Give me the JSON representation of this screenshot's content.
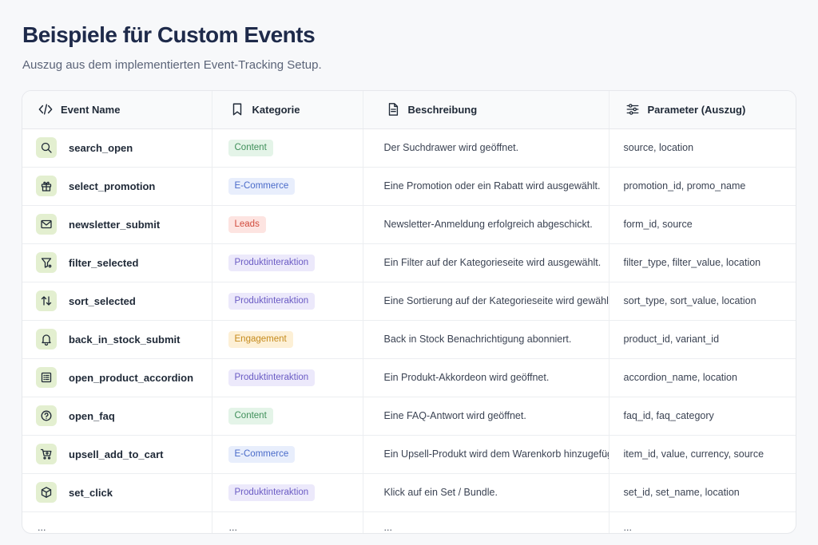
{
  "page": {
    "title": "Beispiele für Custom Events",
    "subtitle": "Auszug aus dem implementierten Event-Tracking Setup."
  },
  "table": {
    "headers": [
      {
        "label": "Event Name",
        "icon": "code-icon"
      },
      {
        "label": "Kategorie",
        "icon": "bookmark-icon"
      },
      {
        "label": "Beschreibung",
        "icon": "document-icon"
      },
      {
        "label": "Parameter (Auszug)",
        "icon": "sliders-icon"
      }
    ],
    "rows": [
      {
        "name": "search_open",
        "icon": "search-icon",
        "category": "Content",
        "description": "Der Suchdrawer wird geöffnet.",
        "params": "source, location"
      },
      {
        "name": "select_promotion",
        "icon": "gift-icon",
        "category": "E-Commerce",
        "description": "Eine Promotion oder ein Rabatt wird ausgewählt.",
        "params": "promotion_id, promo_name"
      },
      {
        "name": "newsletter_submit",
        "icon": "mail-icon",
        "category": "Leads",
        "description": "Newsletter-Anmeldung erfolgreich abgeschickt.",
        "params": "form_id, source"
      },
      {
        "name": "filter_selected",
        "icon": "filter-icon",
        "category": "Produktinteraktion",
        "description": "Ein Filter auf der Kategorieseite wird ausgewählt.",
        "params": "filter_type, filter_value, location"
      },
      {
        "name": "sort_selected",
        "icon": "sort-arrows-icon",
        "category": "Produktinteraktion",
        "description": "Eine Sortierung auf der Kategorieseite wird gewählt.",
        "params": "sort_type, sort_value, location"
      },
      {
        "name": "back_in_stock_submit",
        "icon": "bell-icon",
        "category": "Engagement",
        "description": "Back in Stock Benachrichtigung abonniert.",
        "params": "product_id, variant_id"
      },
      {
        "name": "open_product_accordion",
        "icon": "list-icon",
        "category": "Produktinteraktion",
        "description": "Ein Produkt-Akkordeon wird geöffnet.",
        "params": "accordion_name, location"
      },
      {
        "name": "open_faq",
        "icon": "help-circle-icon",
        "category": "Content",
        "description": "Eine FAQ-Antwort wird geöffnet.",
        "params": "faq_id, faq_category"
      },
      {
        "name": "upsell_add_to_cart",
        "icon": "cart-plus-icon",
        "category": "E-Commerce",
        "description": "Ein Upsell-Produkt wird dem Warenkorb hinzugefügt.",
        "params": "item_id, value, currency, source"
      },
      {
        "name": "set_click",
        "icon": "box-icon",
        "category": "Produktinteraktion",
        "description": "Klick auf ein Set / Bundle.",
        "params": "set_id, set_name, location"
      }
    ],
    "ellipsis": "..."
  },
  "colors": {
    "title": "#1e2a4a",
    "icon_bg": "#e3efd0",
    "badges": {
      "Content": {
        "bg": "#e4f4e8",
        "fg": "#3f8f5a"
      },
      "E-Commerce": {
        "bg": "#e8eefc",
        "fg": "#4a6bc9"
      },
      "Leads": {
        "bg": "#fde4e1",
        "fg": "#d14b3d"
      },
      "Produktinteraktion": {
        "bg": "#ece9fb",
        "fg": "#6a5bc4"
      },
      "Engagement": {
        "bg": "#fdf0d6",
        "fg": "#c58a1c"
      }
    }
  }
}
